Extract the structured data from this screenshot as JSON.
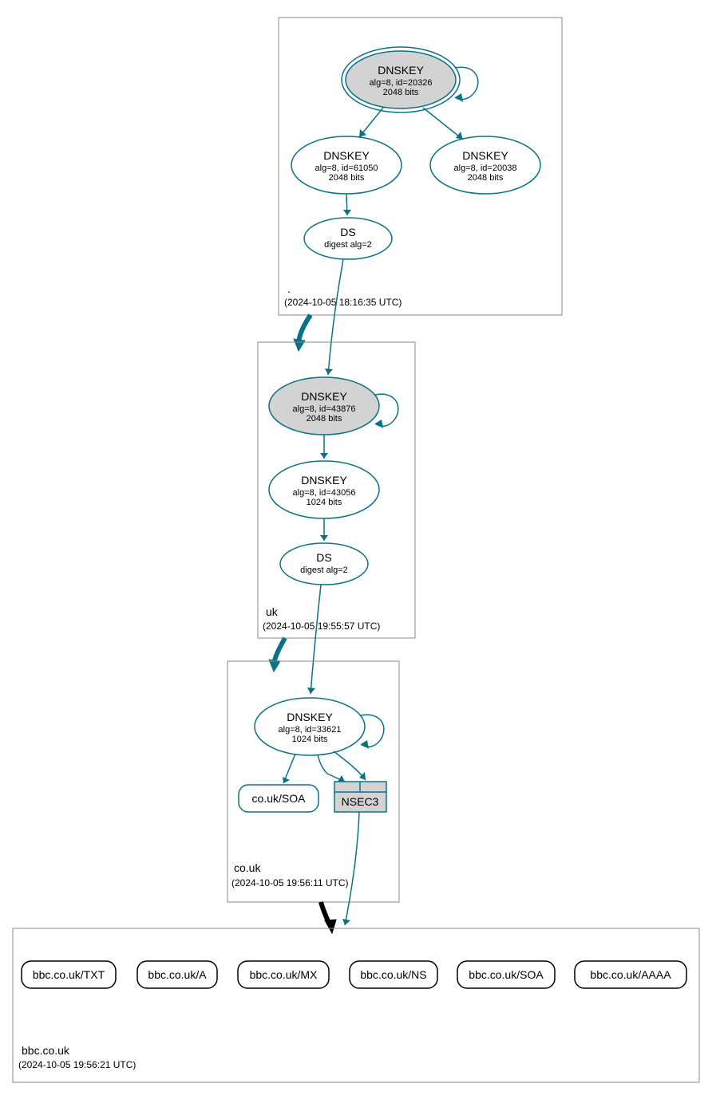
{
  "zones": {
    "root": {
      "name": ".",
      "timestamp": "(2024-10-05 18:16:35 UTC)",
      "ksk": {
        "title": "DNSKEY",
        "line1": "alg=8, id=20326",
        "line2": "2048 bits"
      },
      "zsk1": {
        "title": "DNSKEY",
        "line1": "alg=8, id=61050",
        "line2": "2048 bits"
      },
      "zsk2": {
        "title": "DNSKEY",
        "line1": "alg=8, id=20038",
        "line2": "2048 bits"
      },
      "ds": {
        "title": "DS",
        "line1": "digest alg=2"
      }
    },
    "uk": {
      "name": "uk",
      "timestamp": "(2024-10-05 19:55:57 UTC)",
      "ksk": {
        "title": "DNSKEY",
        "line1": "alg=8, id=43876",
        "line2": "2048 bits"
      },
      "zsk": {
        "title": "DNSKEY",
        "line1": "alg=8, id=43056",
        "line2": "1024 bits"
      },
      "ds": {
        "title": "DS",
        "line1": "digest alg=2"
      }
    },
    "couk": {
      "name": "co.uk",
      "timestamp": "(2024-10-05 19:56:11 UTC)",
      "key": {
        "title": "DNSKEY",
        "line1": "alg=8, id=33621",
        "line2": "1024 bits"
      },
      "soa": "co.uk/SOA",
      "nsec3": "NSEC3"
    },
    "bbc": {
      "name": "bbc.co.uk",
      "timestamp": "(2024-10-05 19:56:21 UTC)",
      "records": [
        "bbc.co.uk/TXT",
        "bbc.co.uk/A",
        "bbc.co.uk/MX",
        "bbc.co.uk/NS",
        "bbc.co.uk/SOA",
        "bbc.co.uk/AAAA"
      ]
    }
  }
}
